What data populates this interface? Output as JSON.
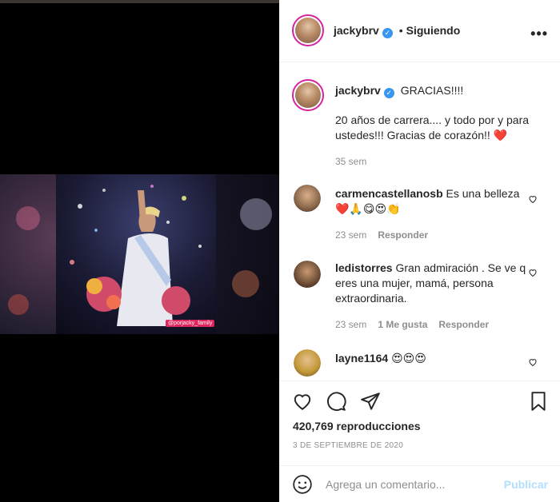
{
  "post": {
    "username": "jackybrv",
    "follow_status": "Siguiendo",
    "watermark": "@porjacky_family"
  },
  "caption": {
    "username": "jackybrv",
    "title": "GRACIAS!!!!",
    "body": "20 años de carrera.... y todo por y para ustedes!!! Gracias de corazón!! ❤️",
    "age": "35 sem"
  },
  "comments": [
    {
      "username": "carmencastellanosb",
      "text": "Es una belleza ❤️🙏😋😍👏",
      "age": "23 sem",
      "reply_label": "Responder"
    },
    {
      "username": "ledistorres",
      "text": "Gran admiración . Se ve q eres una mujer, mamá, persona extraordinaria.",
      "age": "23 sem",
      "likes": "1 Me gusta",
      "reply_label": "Responder"
    },
    {
      "username": "layne1164",
      "text": "😍😍😍"
    }
  ],
  "stats": {
    "views": "420,769 reproducciones",
    "date": "3 DE SEPTIEMBRE DE 2020"
  },
  "composer": {
    "placeholder": "Agrega un comentario...",
    "publish_label": "Publicar"
  },
  "icons": {
    "like": "heart-icon",
    "comment": "comment-icon",
    "share": "share-icon",
    "save": "bookmark-icon",
    "more": "more-options-icon",
    "emoji": "emoji-icon"
  },
  "colors": {
    "verified": "#3897f0",
    "publish_disabled": "#b2dffc",
    "meta_gray": "#8e8e8e",
    "story_ring": "#d6249f"
  }
}
